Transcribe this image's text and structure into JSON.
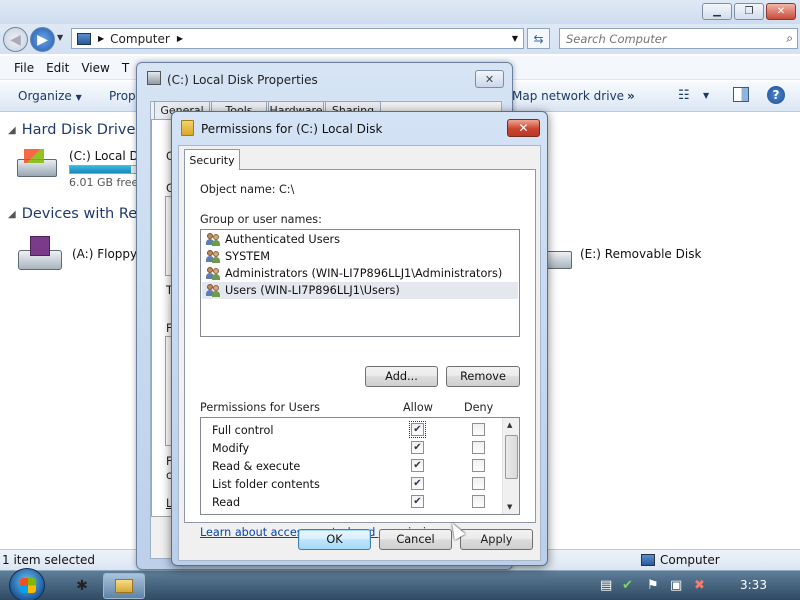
{
  "explorer": {
    "address": "Computer",
    "search_placeholder": "Search Computer",
    "menu": [
      "File",
      "Edit",
      "View",
      "T"
    ],
    "commands": {
      "organize": "Organize",
      "properties": "Prope",
      "map_network": "Map network drive",
      "more": "»"
    },
    "groups": {
      "hard_disk": "Hard Disk Drives",
      "removable": "Devices with Rem"
    },
    "drives": {
      "c_name": "(C:) Local Di",
      "c_free": "6.01 GB free",
      "c_used_fraction": 0.9,
      "a_name": "(A:) Floppy D",
      "e_name": "(E:) Removable Disk"
    },
    "status": {
      "selected": "1 item selected",
      "location": "Computer"
    }
  },
  "taskbar": {
    "clock": "3:33"
  },
  "properties_dialog": {
    "title": "(C:) Local Disk Properties",
    "tabs": [
      "General",
      "Tools",
      "Hardware",
      "Sharing"
    ],
    "side_letters": [
      "C",
      "G",
      "T",
      "F",
      "F",
      "c",
      "L"
    ]
  },
  "permissions_dialog": {
    "title": "Permissions for (C:) Local Disk",
    "tab": "Security",
    "object_label": "Object name:",
    "object_value": "C:\\",
    "group_label": "Group or user names:",
    "groups": [
      {
        "name": "Authenticated Users",
        "selected": false
      },
      {
        "name": "SYSTEM",
        "selected": false
      },
      {
        "name": "Administrators (WIN-LI7P896LLJ1\\Administrators)",
        "selected": false
      },
      {
        "name": "Users (WIN-LI7P896LLJ1\\Users)",
        "selected": true
      }
    ],
    "add_button": "Add...",
    "remove_button": "Remove",
    "perms_label": "Permissions for Users",
    "allow_header": "Allow",
    "deny_header": "Deny",
    "permissions": [
      {
        "name": "Full control",
        "allow": true,
        "deny": false
      },
      {
        "name": "Modify",
        "allow": true,
        "deny": false
      },
      {
        "name": "Read & execute",
        "allow": true,
        "deny": false
      },
      {
        "name": "List folder contents",
        "allow": true,
        "deny": false
      },
      {
        "name": "Read",
        "allow": true,
        "deny": false
      }
    ],
    "learn_link": "Learn about access control and permissions",
    "ok": "OK",
    "cancel": "Cancel",
    "apply": "Apply"
  }
}
